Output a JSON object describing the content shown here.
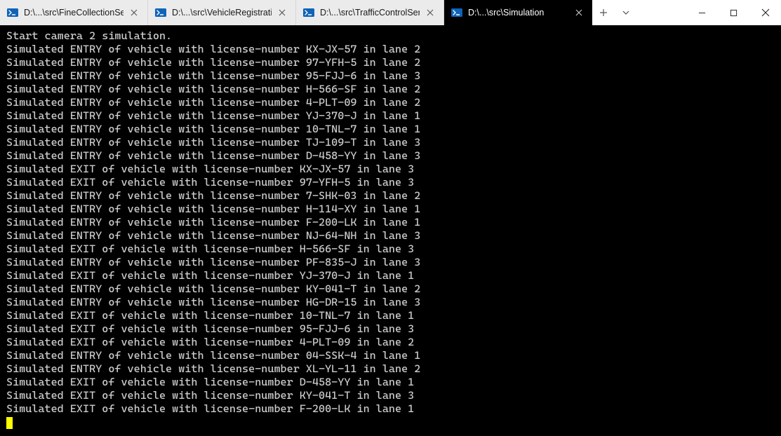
{
  "tabs": [
    {
      "label": "D:\\...\\src\\FineCollectionServ",
      "active": false
    },
    {
      "label": "D:\\...\\src\\VehicleRegistration",
      "active": false
    },
    {
      "label": "D:\\...\\src\\TrafficControlServi",
      "active": false
    },
    {
      "label": "D:\\...\\src\\Simulation",
      "active": true
    }
  ],
  "titlebar": {
    "new_tab_tooltip": "New Tab",
    "dropdown_tooltip": "Open a new tab"
  },
  "window_controls": {
    "minimize": "Minimize",
    "maximize": "Maximize",
    "close": "Close"
  },
  "console": {
    "header": "Start camera 2 simulation.",
    "events": [
      {
        "kind": "ENTRY",
        "plate": "KX-JX-57",
        "lane": 2
      },
      {
        "kind": "ENTRY",
        "plate": "97-YFH-5",
        "lane": 2
      },
      {
        "kind": "ENTRY",
        "plate": "95-FJJ-6",
        "lane": 3
      },
      {
        "kind": "ENTRY",
        "plate": "H-566-SF",
        "lane": 2
      },
      {
        "kind": "ENTRY",
        "plate": "4-PLT-09",
        "lane": 2
      },
      {
        "kind": "ENTRY",
        "plate": "YJ-370-J",
        "lane": 1
      },
      {
        "kind": "ENTRY",
        "plate": "10-TNL-7",
        "lane": 1
      },
      {
        "kind": "ENTRY",
        "plate": "TJ-109-T",
        "lane": 3
      },
      {
        "kind": "ENTRY",
        "plate": "D-458-YY",
        "lane": 3
      },
      {
        "kind": "EXIT",
        "plate": "KX-JX-57",
        "lane": 3
      },
      {
        "kind": "EXIT",
        "plate": "97-YFH-5",
        "lane": 3
      },
      {
        "kind": "ENTRY",
        "plate": "7-SHK-03",
        "lane": 2
      },
      {
        "kind": "ENTRY",
        "plate": "H-114-XY",
        "lane": 1
      },
      {
        "kind": "ENTRY",
        "plate": "F-200-LK",
        "lane": 1
      },
      {
        "kind": "ENTRY",
        "plate": "NJ-64-NH",
        "lane": 3
      },
      {
        "kind": "EXIT",
        "plate": "H-566-SF",
        "lane": 3
      },
      {
        "kind": "ENTRY",
        "plate": "PF-835-J",
        "lane": 3
      },
      {
        "kind": "EXIT",
        "plate": "YJ-370-J",
        "lane": 1
      },
      {
        "kind": "ENTRY",
        "plate": "KY-041-T",
        "lane": 2
      },
      {
        "kind": "ENTRY",
        "plate": "HG-DR-15",
        "lane": 3
      },
      {
        "kind": "EXIT",
        "plate": "10-TNL-7",
        "lane": 1
      },
      {
        "kind": "EXIT",
        "plate": "95-FJJ-6",
        "lane": 3
      },
      {
        "kind": "EXIT",
        "plate": "4-PLT-09",
        "lane": 2
      },
      {
        "kind": "ENTRY",
        "plate": "04-SSK-4",
        "lane": 1
      },
      {
        "kind": "ENTRY",
        "plate": "XL-YL-11",
        "lane": 2
      },
      {
        "kind": "EXIT",
        "plate": "D-458-YY",
        "lane": 1
      },
      {
        "kind": "EXIT",
        "plate": "KY-041-T",
        "lane": 3
      },
      {
        "kind": "EXIT",
        "plate": "F-200-LK",
        "lane": 1
      }
    ]
  }
}
